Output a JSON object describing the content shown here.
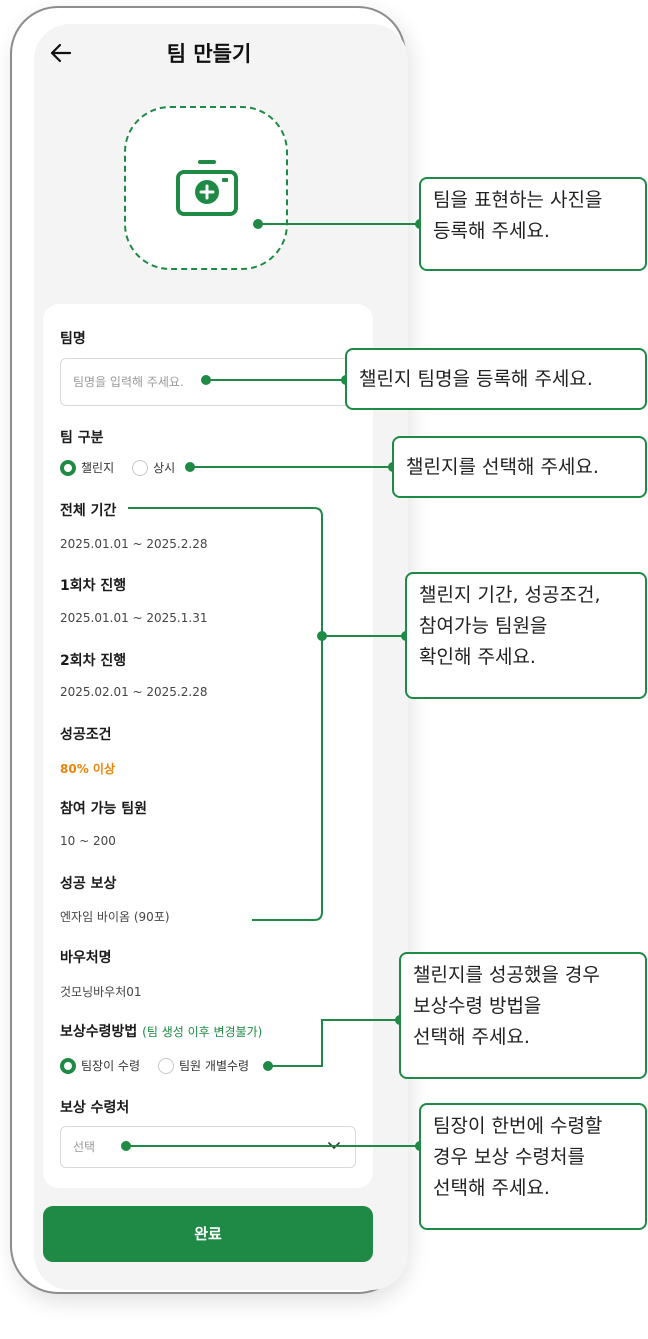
{
  "header": {
    "title": "팀 만들기"
  },
  "form": {
    "team_name_label": "팀명",
    "team_name_placeholder": "팀명을 입력해 주세요.",
    "team_type_label": "팀 구분",
    "team_type_options": [
      "챌린지",
      "상시"
    ],
    "team_type_selected": "챌린지",
    "period_label": "전체 기간",
    "period_value": "2025.01.01 ~ 2025.2.28",
    "round1_label": "1회차 진행",
    "round1_value": "2025.01.01 ~ 2025.1.31",
    "round2_label": "2회차 진행",
    "round2_value": "2025.02.01 ~ 2025.2.28",
    "success_label": "성공조건",
    "success_value": "80% 이상",
    "members_label": "참여 가능 팀원",
    "members_value": "10 ~ 200",
    "reward_label": "성공 보상",
    "reward_value": "엔자임 바이옴 (90포)",
    "voucher_label": "바우처명",
    "voucher_value": "것모닝바우처01",
    "receive_method_label": "보상수령방법",
    "receive_method_hint": "(팀 생성 이후 변경불가)",
    "receive_method_options": [
      "팀장이 수령",
      "팀원 개별수령"
    ],
    "receive_method_selected": "팀장이 수령",
    "receiver_label": "보상 수령처",
    "receiver_value": "선택",
    "done_button": "완료"
  },
  "callouts": {
    "photo": "팀을 표현하는 사진을\n등록해 주세요.",
    "name": "챌린지 팀명을 등록해 주세요.",
    "type": "챌린지를 선택해 주세요.",
    "info": "챌린지 기간, 성공조건,\n참여가능 팀원을\n확인해 주세요.",
    "method": "챌린지를 성공했을 경우\n보상수령 방법을\n선택해 주세요.",
    "receiver": "팀장이 한번에 수령할\n경우 보상 수령처를\n선택해 주세요."
  },
  "colors": {
    "accent": "#1e8a45",
    "highlight": "#e8860b",
    "background": "#f4f4f4"
  },
  "icons": [
    "back-arrow-icon",
    "camera-add-icon",
    "chevron-down-icon"
  ]
}
